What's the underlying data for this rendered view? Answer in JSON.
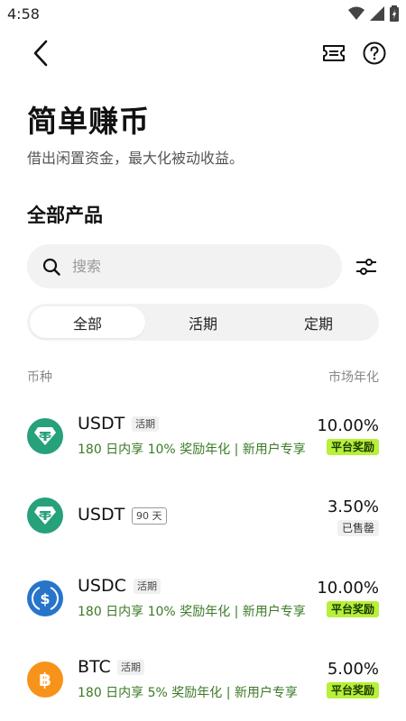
{
  "status_bar": {
    "time": "4:58"
  },
  "header": {
    "title": "简单赚币",
    "subtitle": "借出闲置资金，最大化被动收益。"
  },
  "section": {
    "title": "全部产品"
  },
  "search": {
    "placeholder": "搜索"
  },
  "tabs": [
    {
      "label": "全部",
      "active": true
    },
    {
      "label": "活期",
      "active": false
    },
    {
      "label": "定期",
      "active": false
    }
  ],
  "columns": {
    "left": "币种",
    "right": "市场年化"
  },
  "products": [
    {
      "coin": "USDT",
      "tag": "活期",
      "promo": "180 日内享 10% 奖励年化 | 新用户专享",
      "rate": "10.00%",
      "badge": "平台奖励",
      "icon": "tether-icon",
      "color": "#26a17b"
    },
    {
      "coin": "USDT",
      "tag": "90 天",
      "promo": "",
      "rate": "3.50%",
      "badge": "已售罄",
      "icon": "tether-icon",
      "color": "#26a17b"
    },
    {
      "coin": "USDC",
      "tag": "活期",
      "promo": "180 日内享 10% 奖励年化 | 新用户专享",
      "rate": "10.00%",
      "badge": "平台奖励",
      "icon": "usdc-icon",
      "color": "#2775ca"
    },
    {
      "coin": "BTC",
      "tag": "活期",
      "promo": "180 日内享 5% 奖励年化 | 新用户专享",
      "rate": "5.00%",
      "badge": "平台奖励",
      "icon": "bitcoin-icon",
      "color": "#f7931a"
    }
  ]
}
